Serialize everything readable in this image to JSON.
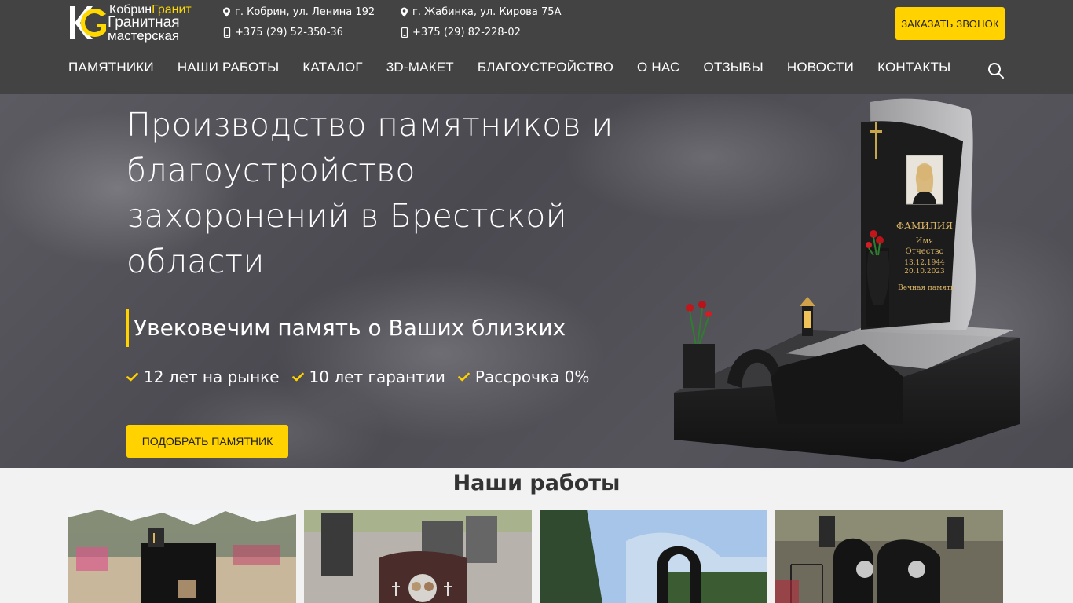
{
  "header": {
    "logo": {
      "top_text_a": "Кобрин",
      "top_text_b": "Гранит",
      "mid_text": "Гранитная",
      "bot_text": "мастерская"
    },
    "contacts": [
      {
        "address": "г. Кобрин, ул. Ленина 192",
        "phone": "+375 (29) 52-350-36"
      },
      {
        "address": "г. Жабинка, ул. Кирова 75А",
        "phone": "+375 (29) 82-228-02"
      }
    ],
    "callback_label": "ЗАКАЗАТЬ ЗВОНОК",
    "nav": [
      "ПАМЯТНИКИ",
      "НАШИ РАБОТЫ",
      "КАТАЛОГ",
      "3D-МАКЕТ",
      "БЛАГОУСТРОЙСТВО",
      "О НАС",
      "ОТЗЫВЫ",
      "НОВОСТИ",
      "КОНТАКТЫ"
    ]
  },
  "hero": {
    "title": "Производство памятников и благоустройство захоронений в Брестской области",
    "subtitle": "Увековечим память о Ваших близких",
    "features": [
      "12 лет на рынке",
      "10 лет гарантии",
      "Рассрочка 0%"
    ],
    "button_label": "ПОДОБРАТЬ ПАМЯТНИК",
    "monument_text": {
      "surname": "ФАМИЛИЯ",
      "name": "Имя",
      "patronymic": "Отчество",
      "born": "13.12.1944",
      "died": "20.10.2023",
      "epitaph": "Вечная память"
    }
  },
  "works": {
    "title": "Наши работы"
  },
  "colors": {
    "accent": "#ffd200",
    "header_bg": "#444343",
    "page_bg": "#f2f2f2"
  }
}
